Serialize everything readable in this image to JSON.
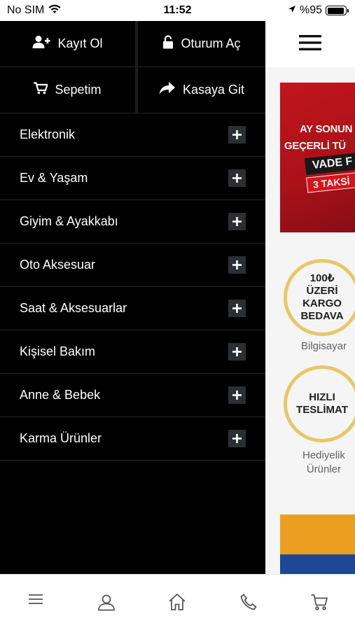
{
  "status_bar": {
    "carrier": "No SIM",
    "time": "11:52",
    "battery": "%95",
    "battery_level": 0.95
  },
  "drawer": {
    "top_actions": [
      {
        "label": "Kayıt Ol",
        "icon": "add-user-icon"
      },
      {
        "label": "Oturum Aç",
        "icon": "unlock-icon"
      },
      {
        "label": "Sepetim",
        "icon": "cart-icon"
      },
      {
        "label": "Kasaya Git",
        "icon": "share-arrow-icon"
      }
    ],
    "categories": [
      {
        "label": "Elektronik"
      },
      {
        "label": "Ev & Yaşam"
      },
      {
        "label": "Giyim & Ayakkabı"
      },
      {
        "label": "Oto Aksesuar"
      },
      {
        "label": "Saat & Aksesuarlar"
      },
      {
        "label": "Kişisel Bakım"
      },
      {
        "label": "Anne & Bebek"
      },
      {
        "label": "Karma Ürünler"
      }
    ]
  },
  "background": {
    "promo_lines": [
      "AY SONUN",
      "GEÇERLİ TÜ",
      "VADE F",
      "3 TAKSİ"
    ],
    "badge1": {
      "lines": [
        "100₺",
        "ÜZERİ",
        "KARGO",
        "BEDAVA"
      ],
      "caption": "Bilgisayar"
    },
    "badge2": {
      "lines": [
        "HIZLI",
        "TESLİMAT"
      ],
      "caption_lines": [
        "Hediyelik",
        "Ürünler"
      ]
    }
  },
  "tab_bar": {
    "tabs": [
      "menu-icon",
      "user-icon",
      "home-icon",
      "phone-icon",
      "cart-icon"
    ]
  },
  "colors": {
    "drawer_bg": "#000000",
    "promo_red": "#c9161f",
    "badge_ring": "#f2d06b"
  }
}
